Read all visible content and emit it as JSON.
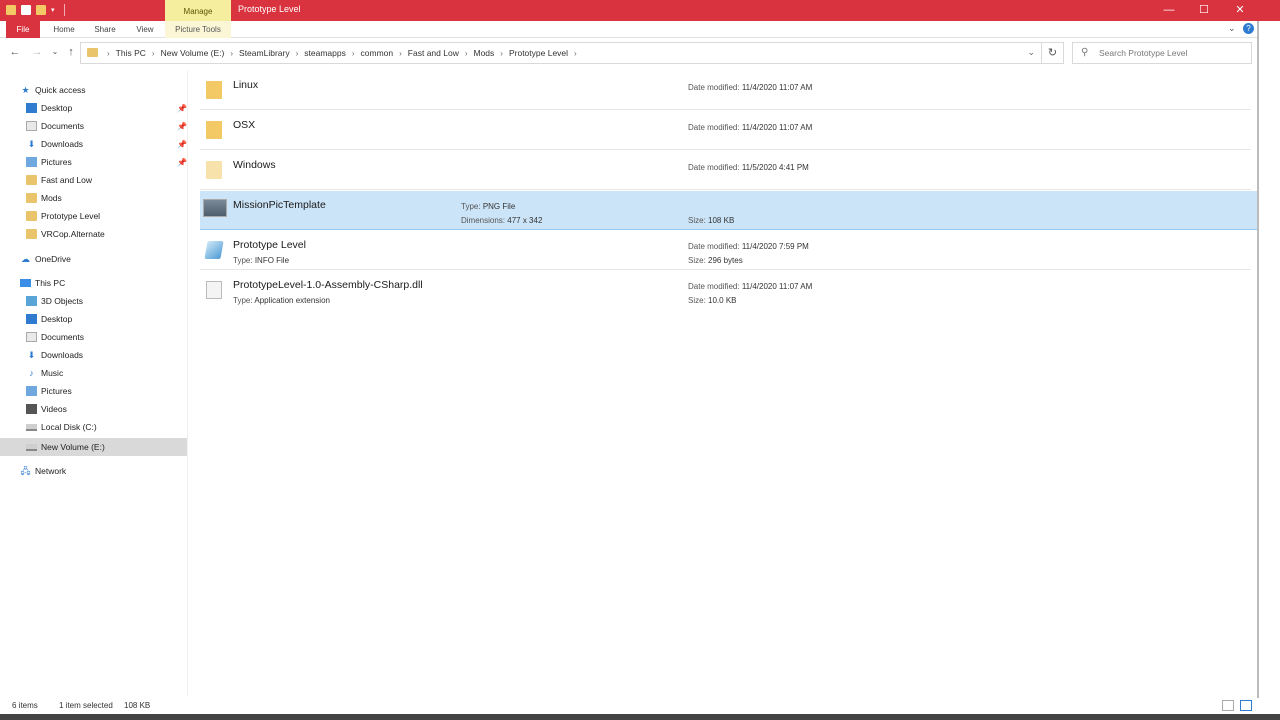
{
  "window": {
    "title": "Prototype Level",
    "contextual_tab": "Manage",
    "minimize": "—",
    "maximize": "☐",
    "close": "✕"
  },
  "ribbon": {
    "tabs": [
      "File",
      "Home",
      "Share",
      "View",
      "Picture Tools"
    ]
  },
  "address": {
    "crumbs": [
      "This PC",
      "New Volume (E:)",
      "SteamLibrary",
      "steamapps",
      "common",
      "Fast and Low",
      "Mods",
      "Prototype Level"
    ],
    "search_placeholder": "Search Prototype Level"
  },
  "nav": {
    "quick_access": "Quick access",
    "quick_items": [
      "Desktop",
      "Documents",
      "Downloads",
      "Pictures",
      "Fast and Low",
      "Mods",
      "Prototype Level",
      "VRCop.Alternate"
    ],
    "onedrive": "OneDrive",
    "this_pc": "This PC",
    "pc_items": [
      "3D Objects",
      "Desktop",
      "Documents",
      "Downloads",
      "Music",
      "Pictures",
      "Videos",
      "Local Disk (C:)",
      "New Volume (E:)"
    ],
    "network": "Network"
  },
  "files": [
    {
      "name": "Linux",
      "modified_label": "Date modified:",
      "modified": "11/4/2020 11:07 AM"
    },
    {
      "name": "OSX",
      "modified_label": "Date modified:",
      "modified": "11/4/2020 11:07 AM"
    },
    {
      "name": "Windows",
      "modified_label": "Date modified:",
      "modified": "11/5/2020 4:41 PM"
    },
    {
      "name": "MissionPicTemplate",
      "type_label": "Type:",
      "type": "PNG File",
      "dims_label": "Dimensions:",
      "dims": "477 x 342",
      "size_label": "Size:",
      "size": "108 KB"
    },
    {
      "name": "Prototype Level",
      "type_label": "Type:",
      "type": "INFO File",
      "modified_label": "Date modified:",
      "modified": "11/4/2020 7:59 PM",
      "size_label": "Size:",
      "size": "296 bytes"
    },
    {
      "name": "PrototypeLevel-1.0-Assembly-CSharp.dll",
      "type_label": "Type:",
      "type": "Application extension",
      "modified_label": "Date modified:",
      "modified": "11/4/2020 11:07 AM",
      "size_label": "Size:",
      "size": "10.0 KB"
    }
  ],
  "status": {
    "items": "6 items",
    "selected": "1 item selected",
    "selected_size": "108 KB"
  },
  "colors": {
    "titlebar": "#d9333f",
    "manage": "#f4ee9e",
    "selection": "#cce4f7"
  }
}
